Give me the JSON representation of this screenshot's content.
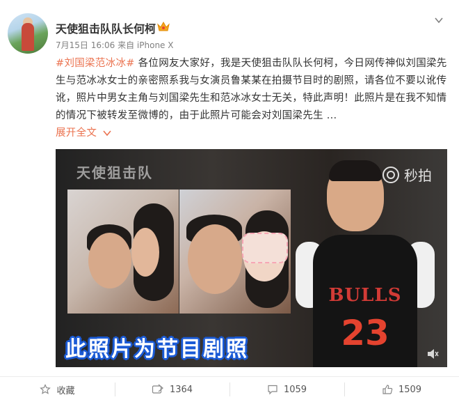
{
  "user": {
    "name": "天使狙击队队长何柯",
    "meta": "7月15日 16:06 来自 iPhone X"
  },
  "post": {
    "hashtag": "#刘国梁范冰冰#",
    "text": " 各位网友大家好，我是天使狙击队队长何柯，今日网传神似刘国梁先生与范冰冰女士的亲密照系我与女演员鲁某某在拍摄节目时的剧照，请各位不要以讹传讹，照片中男女主角与刘国梁先生和范冰冰女士无关，特此声明！此照片是在我不知情的情况下被转发至微博的，由于此照片可能会对刘国梁先生 ...",
    "expand_label": "展开全文",
    "expand_icon": "chevron-down-icon"
  },
  "video": {
    "watermark_left": "天使狙击队",
    "watermark_right": "秒拍",
    "jersey_text": "BULLS",
    "jersey_number": "23",
    "caption": "此照片为节目剧照"
  },
  "actions": {
    "favorite_label": "收藏",
    "repost_count": "1364",
    "comment_count": "1059",
    "like_count": "1509"
  },
  "colors": {
    "accent": "#eb7350",
    "caption_outline": "#1b5bd6"
  }
}
